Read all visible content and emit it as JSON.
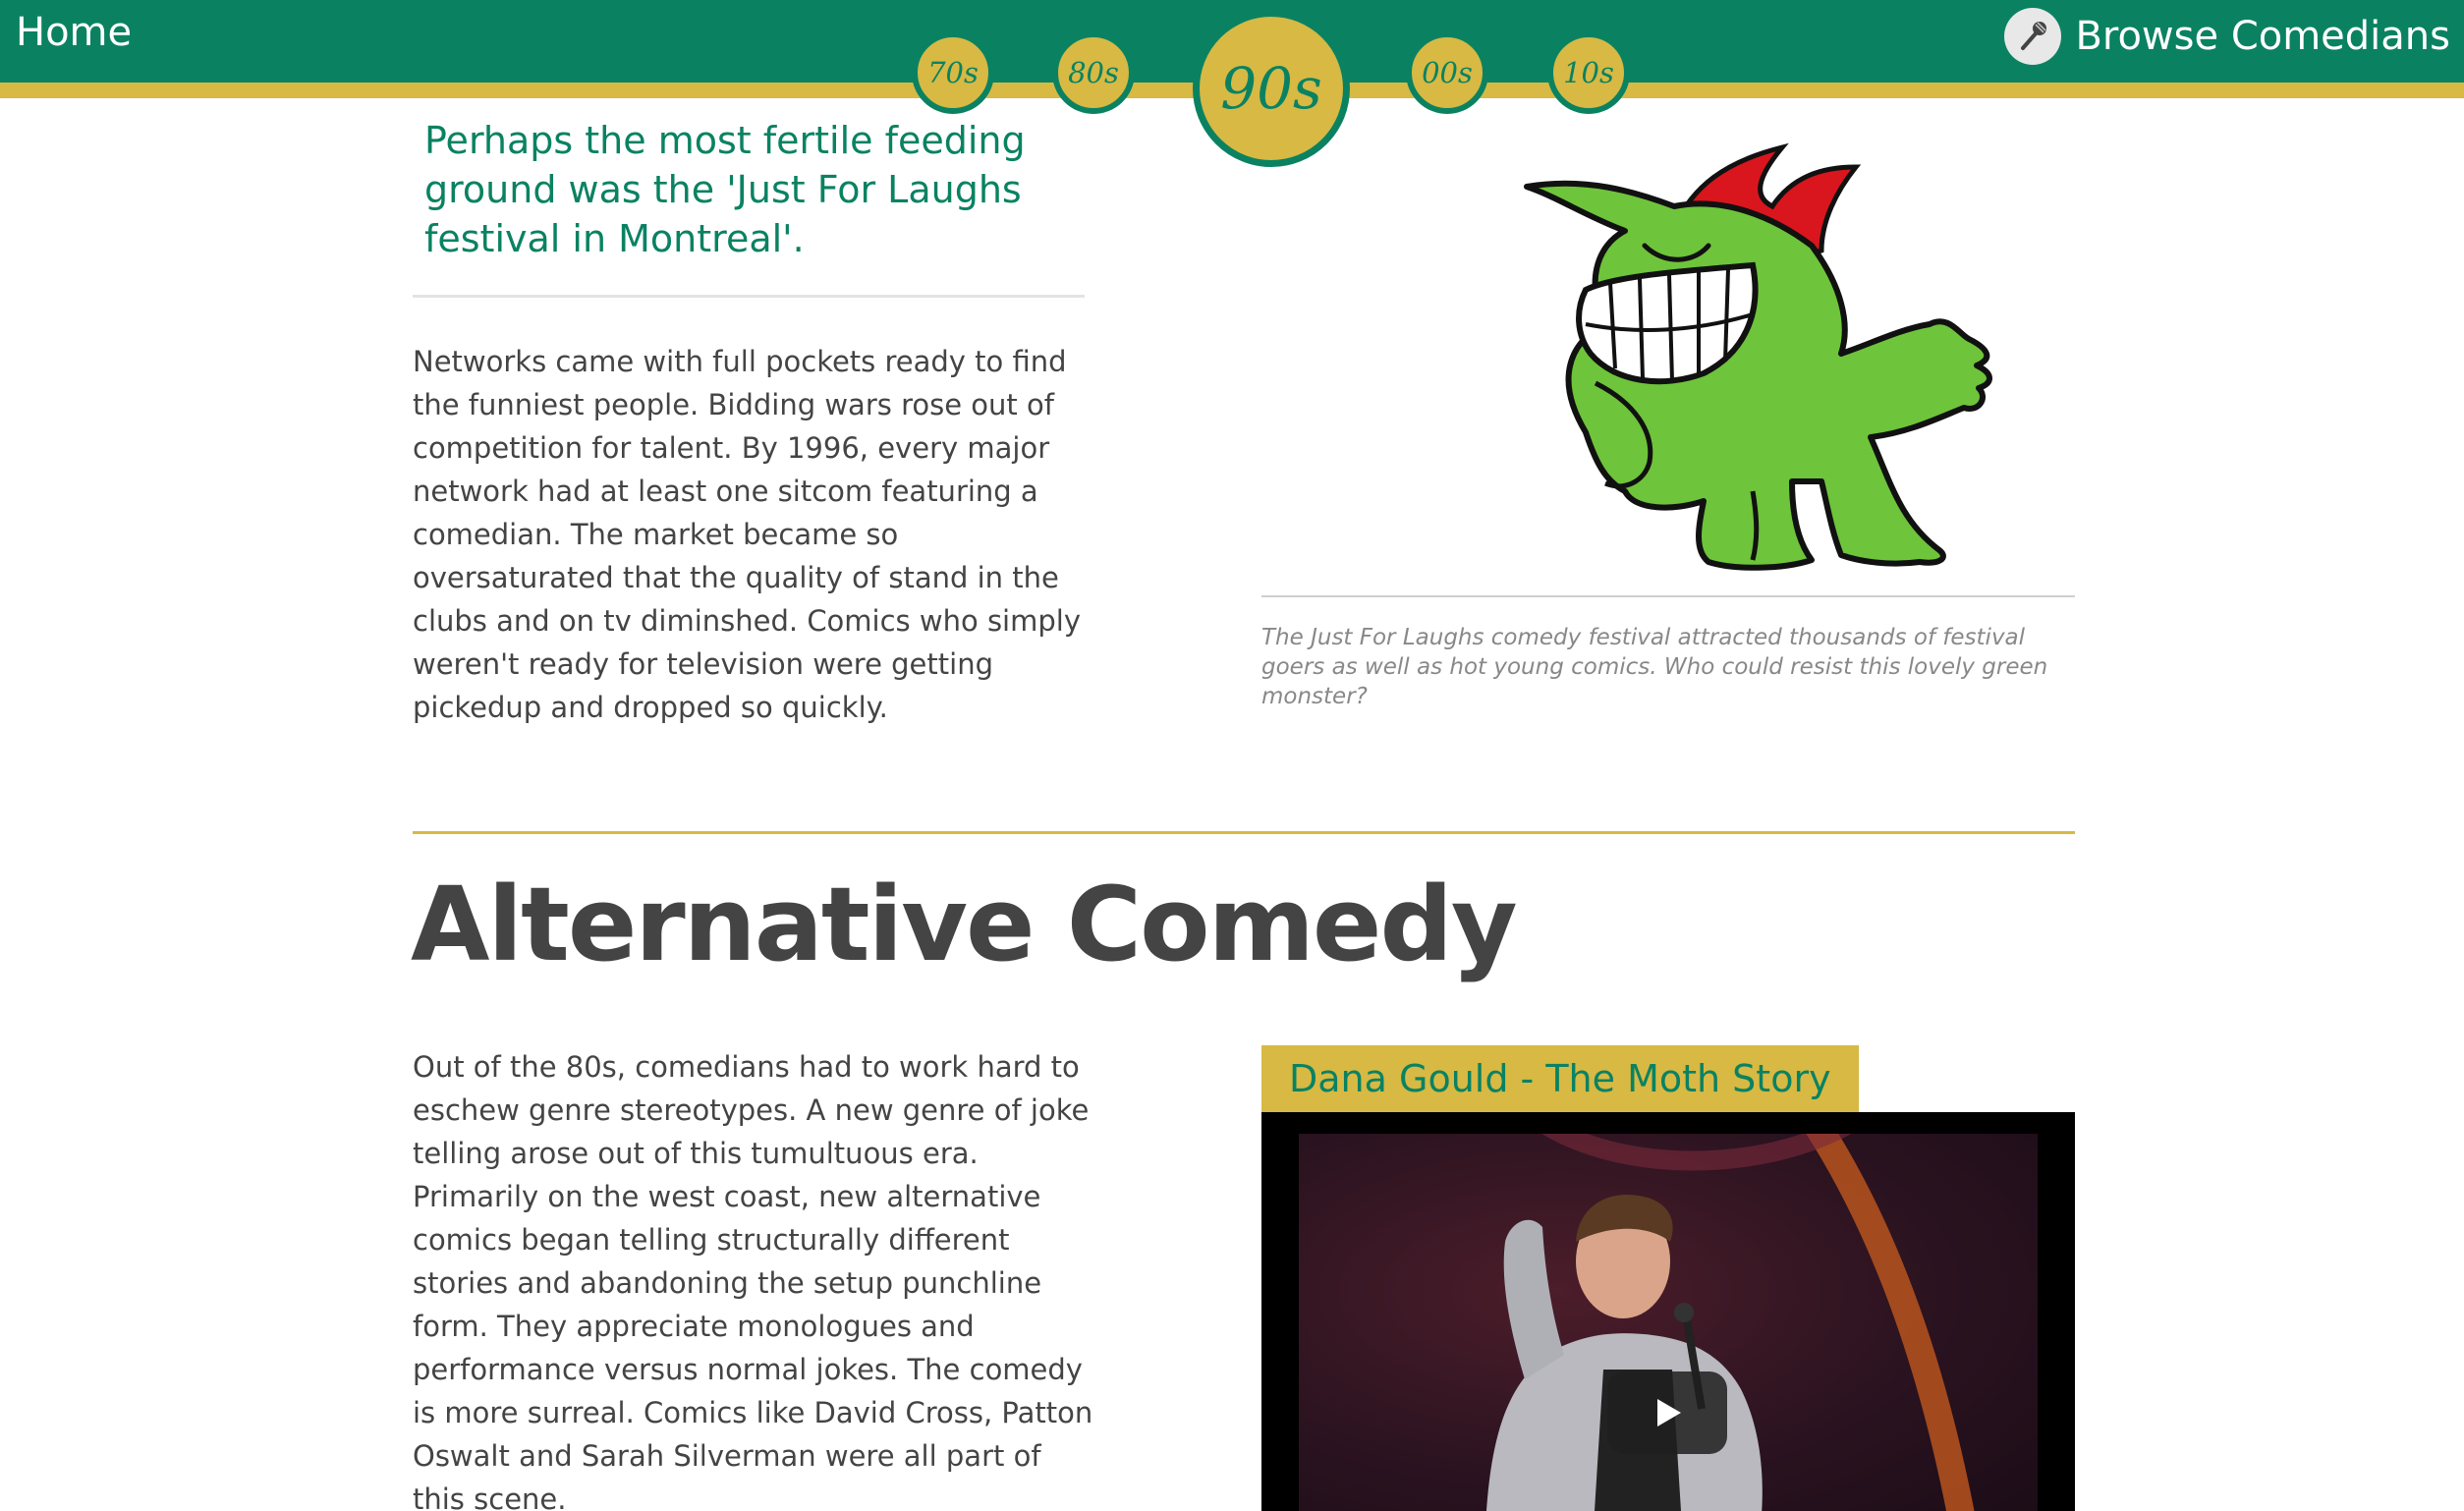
{
  "nav": {
    "home": "Home",
    "browse_label": "Browse Comedians",
    "browse_icon": "microphone-icon",
    "decades": [
      "70s",
      "80s",
      "90s",
      "00s",
      "10s"
    ],
    "active_decade": "90s"
  },
  "festival": {
    "pull_quote": "Perhaps the most fertile feeding ground was the 'Just For Laughs festival in Montreal'.",
    "body": "Networks came with full pockets ready to find the funniest people. Bidding wars rose out of competition for talent. By 1996, every major network had at least one sitcom featuring a comedian. The market became so oversaturated that the quality of stand in the clubs and on tv diminshed. Comics who simply weren't ready for television were getting pickedup and dropped so quickly.",
    "image_icon": "just-for-laughs-mascot-icon",
    "caption": "The Just For Laughs comedy festival attracted thousands of festival goers as well as hot young comics. Who could resist this lovely green monster?"
  },
  "alternative": {
    "title": "Alternative Comedy",
    "body": "Out of the 80s, comedians had to work hard to eschew genre stereotypes. A new genre of joke telling arose out of this tumultuous era. Primarily on the west coast, new alternative comics began telling structurally different stories and abandoning the setup punchline form. They appreciate monologues and performance versus normal jokes. The comedy is more surreal. Comics like David Cross, Patton Oswalt and Sarah Silverman were all part of this scene.",
    "video_title": "Dana Gould - The Moth Story",
    "play_icon": "play-icon"
  },
  "colors": {
    "green": "#0a8262",
    "gold": "#d7b944",
    "text": "#444444",
    "caption": "#888888"
  }
}
